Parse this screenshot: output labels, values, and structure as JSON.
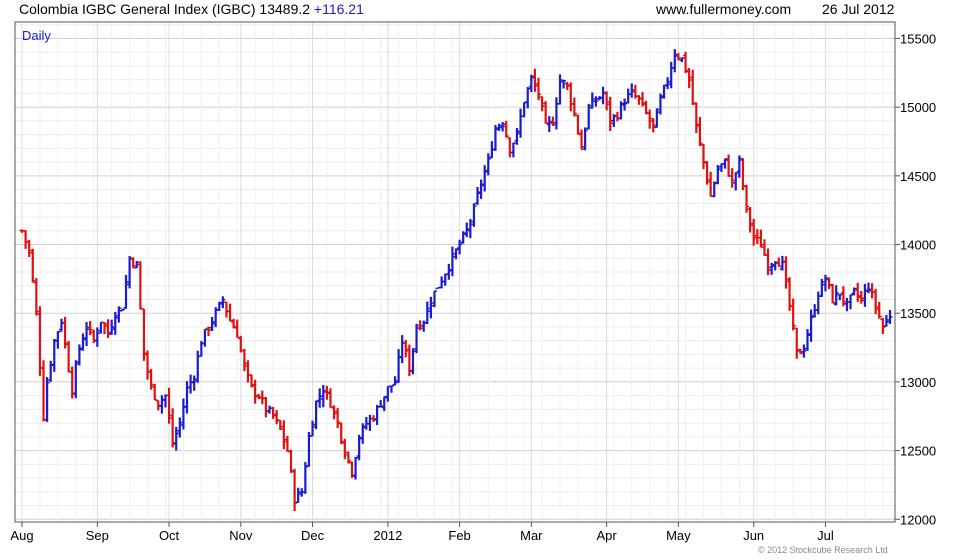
{
  "header": {
    "title": "Colombia IGBC General Index (IGBC) 13489.2",
    "change": "+116.21",
    "website": "www.fullermoney.com",
    "date": "26 Jul 2012"
  },
  "footer": {
    "credit": "© 2012 Stockcube Research Ltd"
  },
  "colors": {
    "up": "#1a1ad0",
    "down": "#e01010",
    "grid": "#dddddd",
    "axis": "#555555"
  },
  "chart_data": {
    "type": "ohlc",
    "period_label": "Daily",
    "ylim": [
      11980,
      15620
    ],
    "y_ticks": [
      12000,
      12500,
      13000,
      13500,
      14000,
      14500,
      15000,
      15500
    ],
    "y_tick_labels": [
      "12000",
      "12500",
      "13000",
      "13500",
      "14000",
      "14500",
      "15000",
      "15500"
    ],
    "x_ticks": [
      {
        "label": "Aug",
        "day": 0
      },
      {
        "label": "Sep",
        "day": 21
      },
      {
        "label": "Oct",
        "day": 41
      },
      {
        "label": "Nov",
        "day": 61
      },
      {
        "label": "Dec",
        "day": 81
      },
      {
        "label": "2012",
        "day": 102
      },
      {
        "label": "Feb",
        "day": 122
      },
      {
        "label": "Mar",
        "day": 142
      },
      {
        "label": "Apr",
        "day": 163
      },
      {
        "label": "May",
        "day": 183
      },
      {
        "label": "Jun",
        "day": 204
      },
      {
        "label": "Jul",
        "day": 224
      }
    ],
    "total_days": 243,
    "close_path": [
      [
        0,
        14100
      ],
      [
        2,
        13950
      ],
      [
        4,
        13500
      ],
      [
        6,
        12750
      ],
      [
        7,
        13000
      ],
      [
        9,
        13300
      ],
      [
        11,
        13450
      ],
      [
        13,
        13100
      ],
      [
        14,
        12950
      ],
      [
        16,
        13250
      ],
      [
        18,
        13400
      ],
      [
        20,
        13300
      ],
      [
        22,
        13450
      ],
      [
        24,
        13350
      ],
      [
        26,
        13500
      ],
      [
        28,
        13550
      ],
      [
        30,
        13900
      ],
      [
        32,
        13850
      ],
      [
        34,
        13200
      ],
      [
        36,
        12950
      ],
      [
        38,
        12850
      ],
      [
        40,
        12900
      ],
      [
        42,
        12550
      ],
      [
        44,
        12700
      ],
      [
        46,
        12950
      ],
      [
        48,
        13050
      ],
      [
        50,
        13300
      ],
      [
        52,
        13400
      ],
      [
        54,
        13500
      ],
      [
        56,
        13600
      ],
      [
        58,
        13450
      ],
      [
        60,
        13350
      ],
      [
        62,
        13100
      ],
      [
        64,
        12950
      ],
      [
        66,
        12900
      ],
      [
        68,
        12800
      ],
      [
        70,
        12750
      ],
      [
        72,
        12650
      ],
      [
        74,
        12500
      ],
      [
        76,
        12150
      ],
      [
        78,
        12200
      ],
      [
        80,
        12600
      ],
      [
        82,
        12850
      ],
      [
        84,
        12950
      ],
      [
        86,
        12850
      ],
      [
        88,
        12700
      ],
      [
        90,
        12500
      ],
      [
        92,
        12350
      ],
      [
        94,
        12600
      ],
      [
        96,
        12700
      ],
      [
        98,
        12750
      ],
      [
        100,
        12850
      ],
      [
        102,
        12950
      ],
      [
        104,
        13000
      ],
      [
        106,
        13300
      ],
      [
        108,
        13100
      ],
      [
        110,
        13400
      ],
      [
        112,
        13450
      ],
      [
        114,
        13600
      ],
      [
        116,
        13700
      ],
      [
        118,
        13800
      ],
      [
        120,
        13900
      ],
      [
        122,
        14000
      ],
      [
        124,
        14100
      ],
      [
        126,
        14250
      ],
      [
        128,
        14450
      ],
      [
        130,
        14600
      ],
      [
        132,
        14850
      ],
      [
        134,
        14900
      ],
      [
        136,
        14700
      ],
      [
        138,
        14800
      ],
      [
        140,
        15050
      ],
      [
        142,
        15200
      ],
      [
        144,
        15100
      ],
      [
        146,
        14850
      ],
      [
        148,
        14900
      ],
      [
        150,
        15200
      ],
      [
        152,
        15150
      ],
      [
        154,
        14950
      ],
      [
        156,
        14700
      ],
      [
        158,
        15000
      ],
      [
        160,
        15050
      ],
      [
        162,
        15100
      ],
      [
        164,
        14900
      ],
      [
        166,
        14950
      ],
      [
        168,
        15050
      ],
      [
        170,
        15100
      ],
      [
        172,
        15050
      ],
      [
        174,
        14950
      ],
      [
        176,
        14850
      ],
      [
        178,
        15050
      ],
      [
        180,
        15200
      ],
      [
        182,
        15400
      ],
      [
        184,
        15350
      ],
      [
        186,
        15200
      ],
      [
        188,
        14850
      ],
      [
        190,
        14600
      ],
      [
        192,
        14350
      ],
      [
        194,
        14550
      ],
      [
        196,
        14600
      ],
      [
        198,
        14450
      ],
      [
        200,
        14600
      ],
      [
        202,
        14250
      ],
      [
        204,
        14050
      ],
      [
        206,
        14000
      ],
      [
        208,
        13850
      ],
      [
        210,
        13900
      ],
      [
        212,
        13850
      ],
      [
        214,
        13550
      ],
      [
        216,
        13200
      ],
      [
        218,
        13250
      ],
      [
        220,
        13450
      ],
      [
        222,
        13650
      ],
      [
        224,
        13750
      ],
      [
        226,
        13600
      ],
      [
        228,
        13650
      ],
      [
        230,
        13550
      ],
      [
        232,
        13650
      ],
      [
        234,
        13600
      ],
      [
        236,
        13700
      ],
      [
        238,
        13550
      ],
      [
        240,
        13400
      ],
      [
        242,
        13489
      ]
    ]
  }
}
